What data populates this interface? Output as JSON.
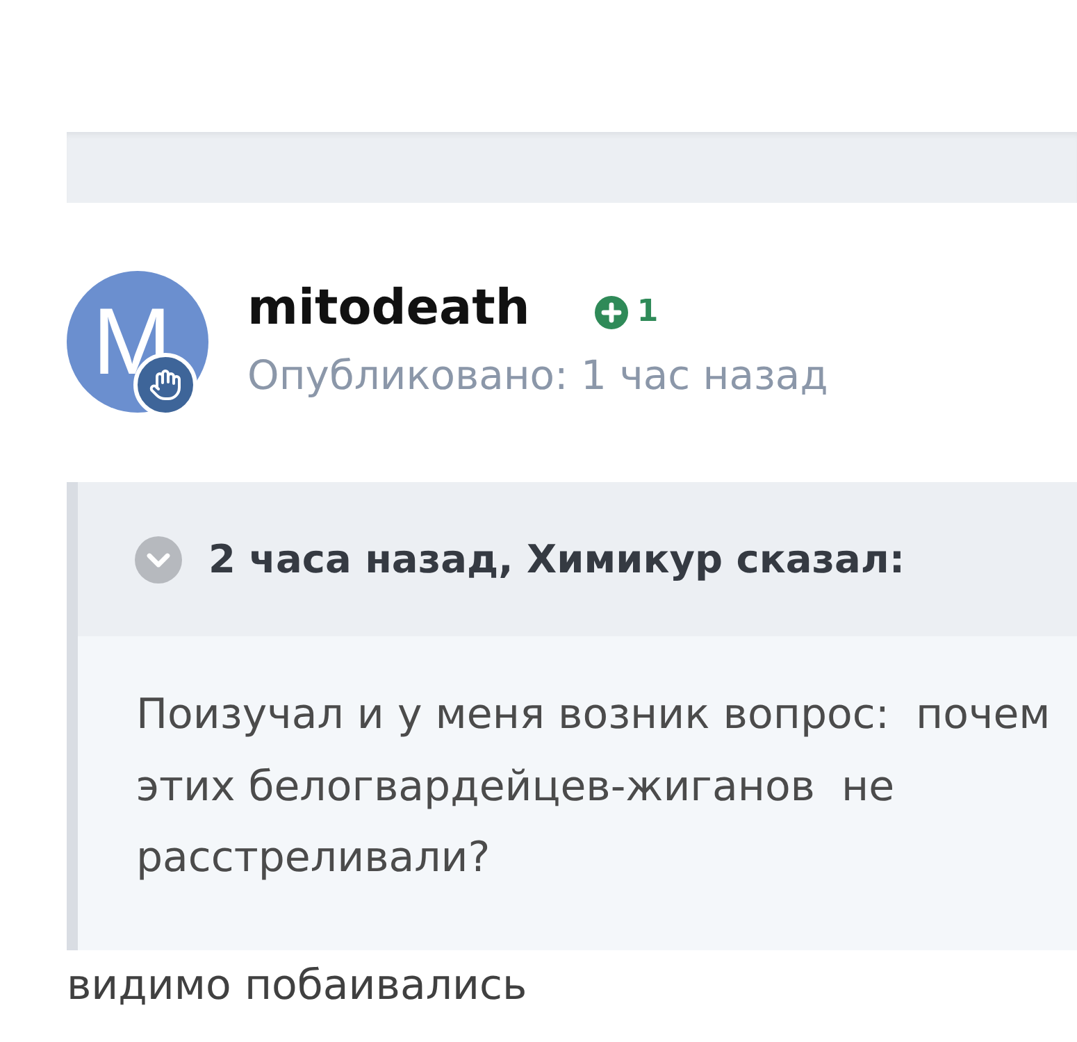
{
  "post": {
    "author": {
      "avatar_letter": "M",
      "name": "mitodeath",
      "reputation": "1"
    },
    "published": "Опубликовано: 1 час назад",
    "quote": {
      "citation": "2 часа назад, Химикур сказал:",
      "text": "Поизучал и у меня возник вопрос:  почем\nэтих белогвардейцев-жиганов  не\nрасстреливали?"
    },
    "body": "видимо побаивались"
  }
}
